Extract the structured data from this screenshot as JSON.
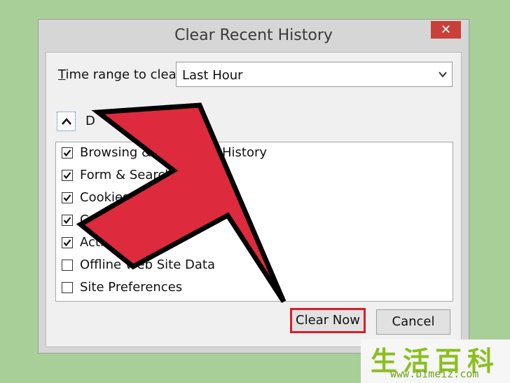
{
  "dialog": {
    "title": "Clear Recent History",
    "close_glyph": "✕"
  },
  "time_range": {
    "label_prefix": "T",
    "label_rest": "ime range to clear:",
    "value": "Last Hour"
  },
  "details": {
    "label": "D"
  },
  "items": [
    {
      "label": "Browsing & Download History",
      "checked": true
    },
    {
      "label": "Form & Search History",
      "checked": true
    },
    {
      "label": "Cookies",
      "checked": true
    },
    {
      "label": "Cache",
      "checked": true
    },
    {
      "label": "Active Logins",
      "checked": true
    },
    {
      "label": "Offline Web Site Data",
      "checked": false
    },
    {
      "label": "Site Preferences",
      "checked": false
    }
  ],
  "buttons": {
    "clear_now": "Clear Now",
    "cancel": "Cancel"
  },
  "colors": {
    "arrow": "#dd2b3d",
    "highlight": "#d4202a",
    "background": "#a9cf98"
  },
  "watermark": {
    "chars": "生活百科",
    "url": "www.bimeiz.com"
  }
}
